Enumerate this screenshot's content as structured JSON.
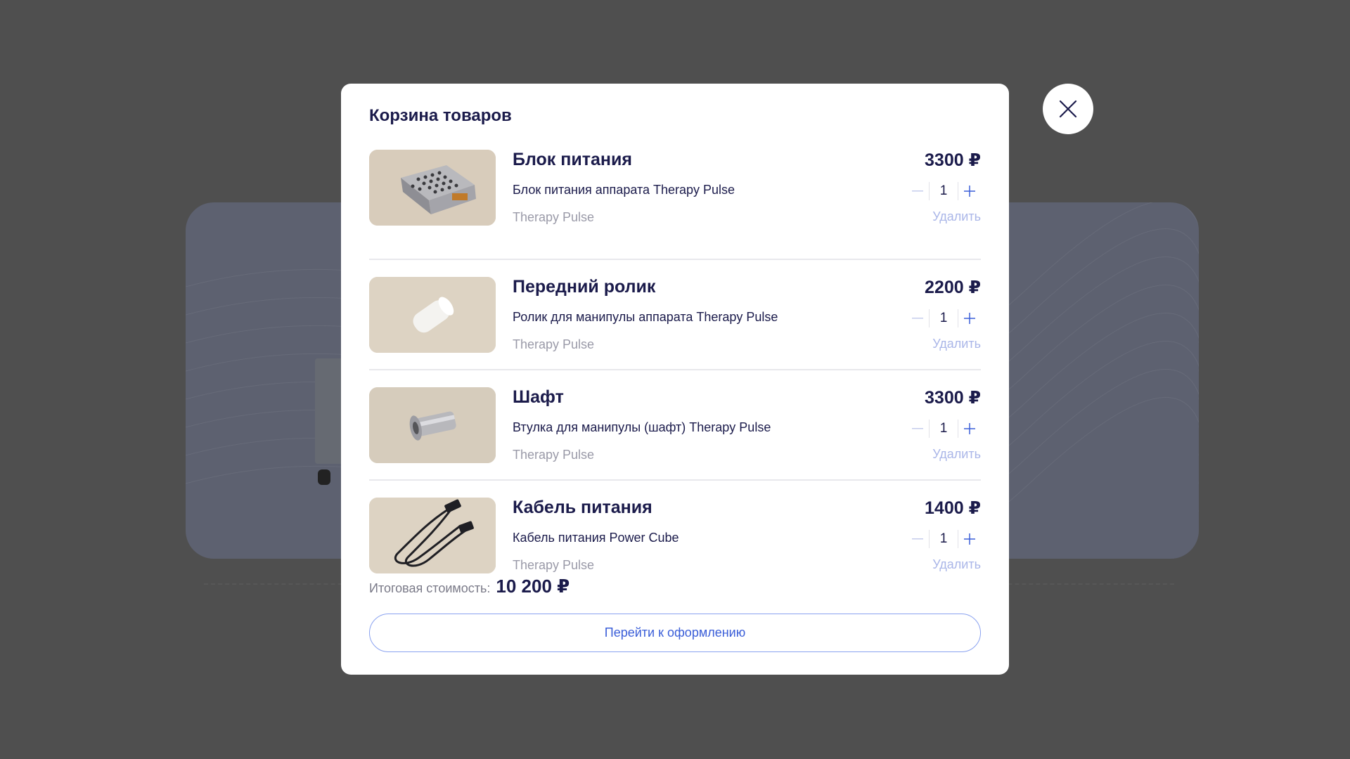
{
  "cart": {
    "title": "Корзина товаров",
    "items": [
      {
        "name": "Блок питания",
        "description": "Блок питания аппарата Therapy Pulse",
        "brand": "Therapy Pulse",
        "price": "3300 ₽",
        "quantity": "1",
        "remove_label": "Удалить",
        "image_icon": "power-supply-image"
      },
      {
        "name": "Передний ролик",
        "description": "Ролик для манипулы аппарата Therapy Pulse",
        "brand": "Therapy Pulse",
        "price": "2200 ₽",
        "quantity": "1",
        "remove_label": "Удалить",
        "image_icon": "roller-image"
      },
      {
        "name": "Шафт",
        "description": "Втулка для манипулы (шафт) Therapy Pulse",
        "brand": "Therapy Pulse",
        "price": "3300 ₽",
        "quantity": "1",
        "remove_label": "Удалить",
        "image_icon": "shaft-image"
      },
      {
        "name": "Кабель питания",
        "description": "Кабель питания Power Cube",
        "brand": "Therapy Pulse",
        "price": "1400 ₽",
        "quantity": "1",
        "remove_label": "Удалить",
        "image_icon": "power-cable-image"
      }
    ],
    "total_label": "Итоговая стоимость:",
    "total_value": "10 200 ₽",
    "checkout_label": "Перейти к оформлению"
  },
  "colors": {
    "overlay": "#4f4f4f",
    "text_dark": "#1b1b4b",
    "text_muted": "#9a9aa8",
    "accent": "#3a5ed8",
    "remove_link": "#aab6e8"
  }
}
